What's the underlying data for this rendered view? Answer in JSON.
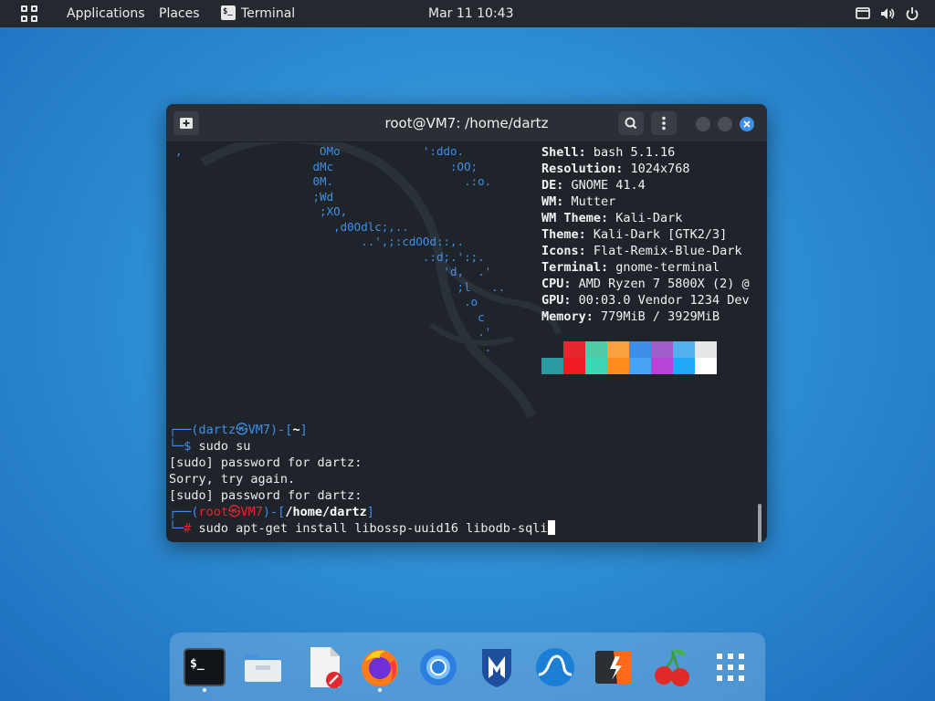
{
  "topbar": {
    "apps_label": "Applications",
    "places_label": "Places",
    "terminal_label": "Terminal",
    "terminal_icon_glyph": "$_",
    "clock": "Mar 11  10:43"
  },
  "window": {
    "title": "root@VM7: /home/dartz"
  },
  "neofetch": {
    "ascii": ",                    OMo            ':ddo.\n                    dMc                 :OO;\n                    0M.                   .:o.\n                    ;Wd\n                     ;XO,\n                       ,d0Odlc;,..\n                           ..',;:cdOOd::,.\n                                    .:d;.':;.\n                                       'd,  .'\n                                         ;l   ..\n                                          .o\n                                            c\n                                            .'\n                                             .",
    "info": [
      {
        "key": "Shell:",
        "value": " bash 5.1.16"
      },
      {
        "key": "Resolution:",
        "value": " 1024x768"
      },
      {
        "key": "DE:",
        "value": " GNOME 41.4"
      },
      {
        "key": "WM:",
        "value": " Mutter"
      },
      {
        "key": "WM Theme:",
        "value": " Kali-Dark"
      },
      {
        "key": "Theme:",
        "value": " Kali-Dark [GTK2/3]"
      },
      {
        "key": "Icons:",
        "value": " Flat-Remix-Blue-Dark"
      },
      {
        "key": "Terminal:",
        "value": " gnome-terminal"
      },
      {
        "key": "CPU:",
        "value": " AMD Ryzen 7 5800X (2) @"
      },
      {
        "key": "GPU:",
        "value": " 00:03.0 Vendor 1234 Dev"
      },
      {
        "key": "Memory:",
        "value": " 779MiB / 3929MiB"
      }
    ],
    "palette_top": [
      "#1f242a",
      "#e5272e",
      "#4fcba8",
      "#f9a03f",
      "#3f8fe8",
      "#a25ec8",
      "#54b1f0",
      "#e6e6e6"
    ],
    "palette_bottom": [
      "#2a9aa0",
      "#f01b22",
      "#3fd6b5",
      "#ff8c1a",
      "#4aa2f5",
      "#b744d6",
      "#1fa8f7",
      "#ffffff"
    ]
  },
  "session": {
    "l1_open": "┌──(",
    "l1_user": "dartz㉿VM7",
    "l1_mid": ")-[",
    "l1_dir": "~",
    "l1_close": "]",
    "l2_prefix": "└─",
    "l2_sym": "$",
    "l2_cmd": " sudo su",
    "l3": "[sudo] password for dartz:",
    "l4": "Sorry, try again.",
    "l5": "[sudo] password for dartz:",
    "l6_open": "┌──(",
    "l6_user": "root㉿VM7",
    "l6_mid": ")-[",
    "l6_dir": "/home/dartz",
    "l6_close": "]",
    "l7_prefix": "└─",
    "l7_sym": "#",
    "l7_cmd": " sudo apt-get install libossp-uuid16 libodb-sqli"
  },
  "dock": {
    "items": [
      "terminal-icon",
      "files-icon",
      "text-editor-icon",
      "firefox-icon",
      "chromium-icon",
      "metasploit-icon",
      "wireshark-icon",
      "burpsuite-icon",
      "cherrytree-icon",
      "app-grid-icon"
    ]
  }
}
